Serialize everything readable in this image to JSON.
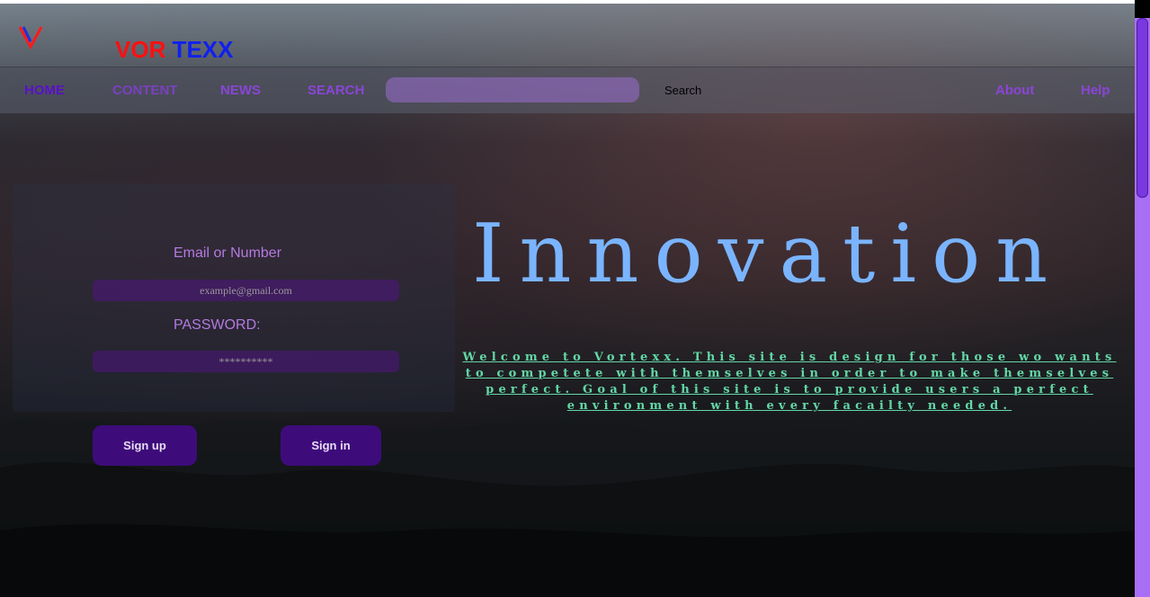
{
  "brand": {
    "part1": "VOR",
    "part2": "TEXX",
    "logo_icon": "v-logo-icon"
  },
  "nav": {
    "home": "HOME",
    "content": "CONTENT",
    "news": "NEWS",
    "search": "SEARCH",
    "search_button": "Search",
    "search_input_value": "",
    "about": "About",
    "help": "Help"
  },
  "login": {
    "email_label": "Email or Number",
    "email_placeholder": "example@gmail.com",
    "password_label": "PASSWORD:",
    "password_placeholder": "**********",
    "signup_label": "Sign up",
    "signin_label": "Sign in"
  },
  "hero": {
    "title": "Innovation",
    "welcome_text": "Welcome to Vortexx. This site is design for those wo wants to competete with themselves in order to make themselves perfect. Goal of this site is to provide users a perfect environment with every facailty needed."
  },
  "colors": {
    "accent": "#8a45d6",
    "brand_red": "#ff1010",
    "brand_blue": "#1020ee",
    "hero_blue": "#7ab4ff",
    "welcome_green": "#62d7a6",
    "button_bg": "#3d0c7a"
  }
}
